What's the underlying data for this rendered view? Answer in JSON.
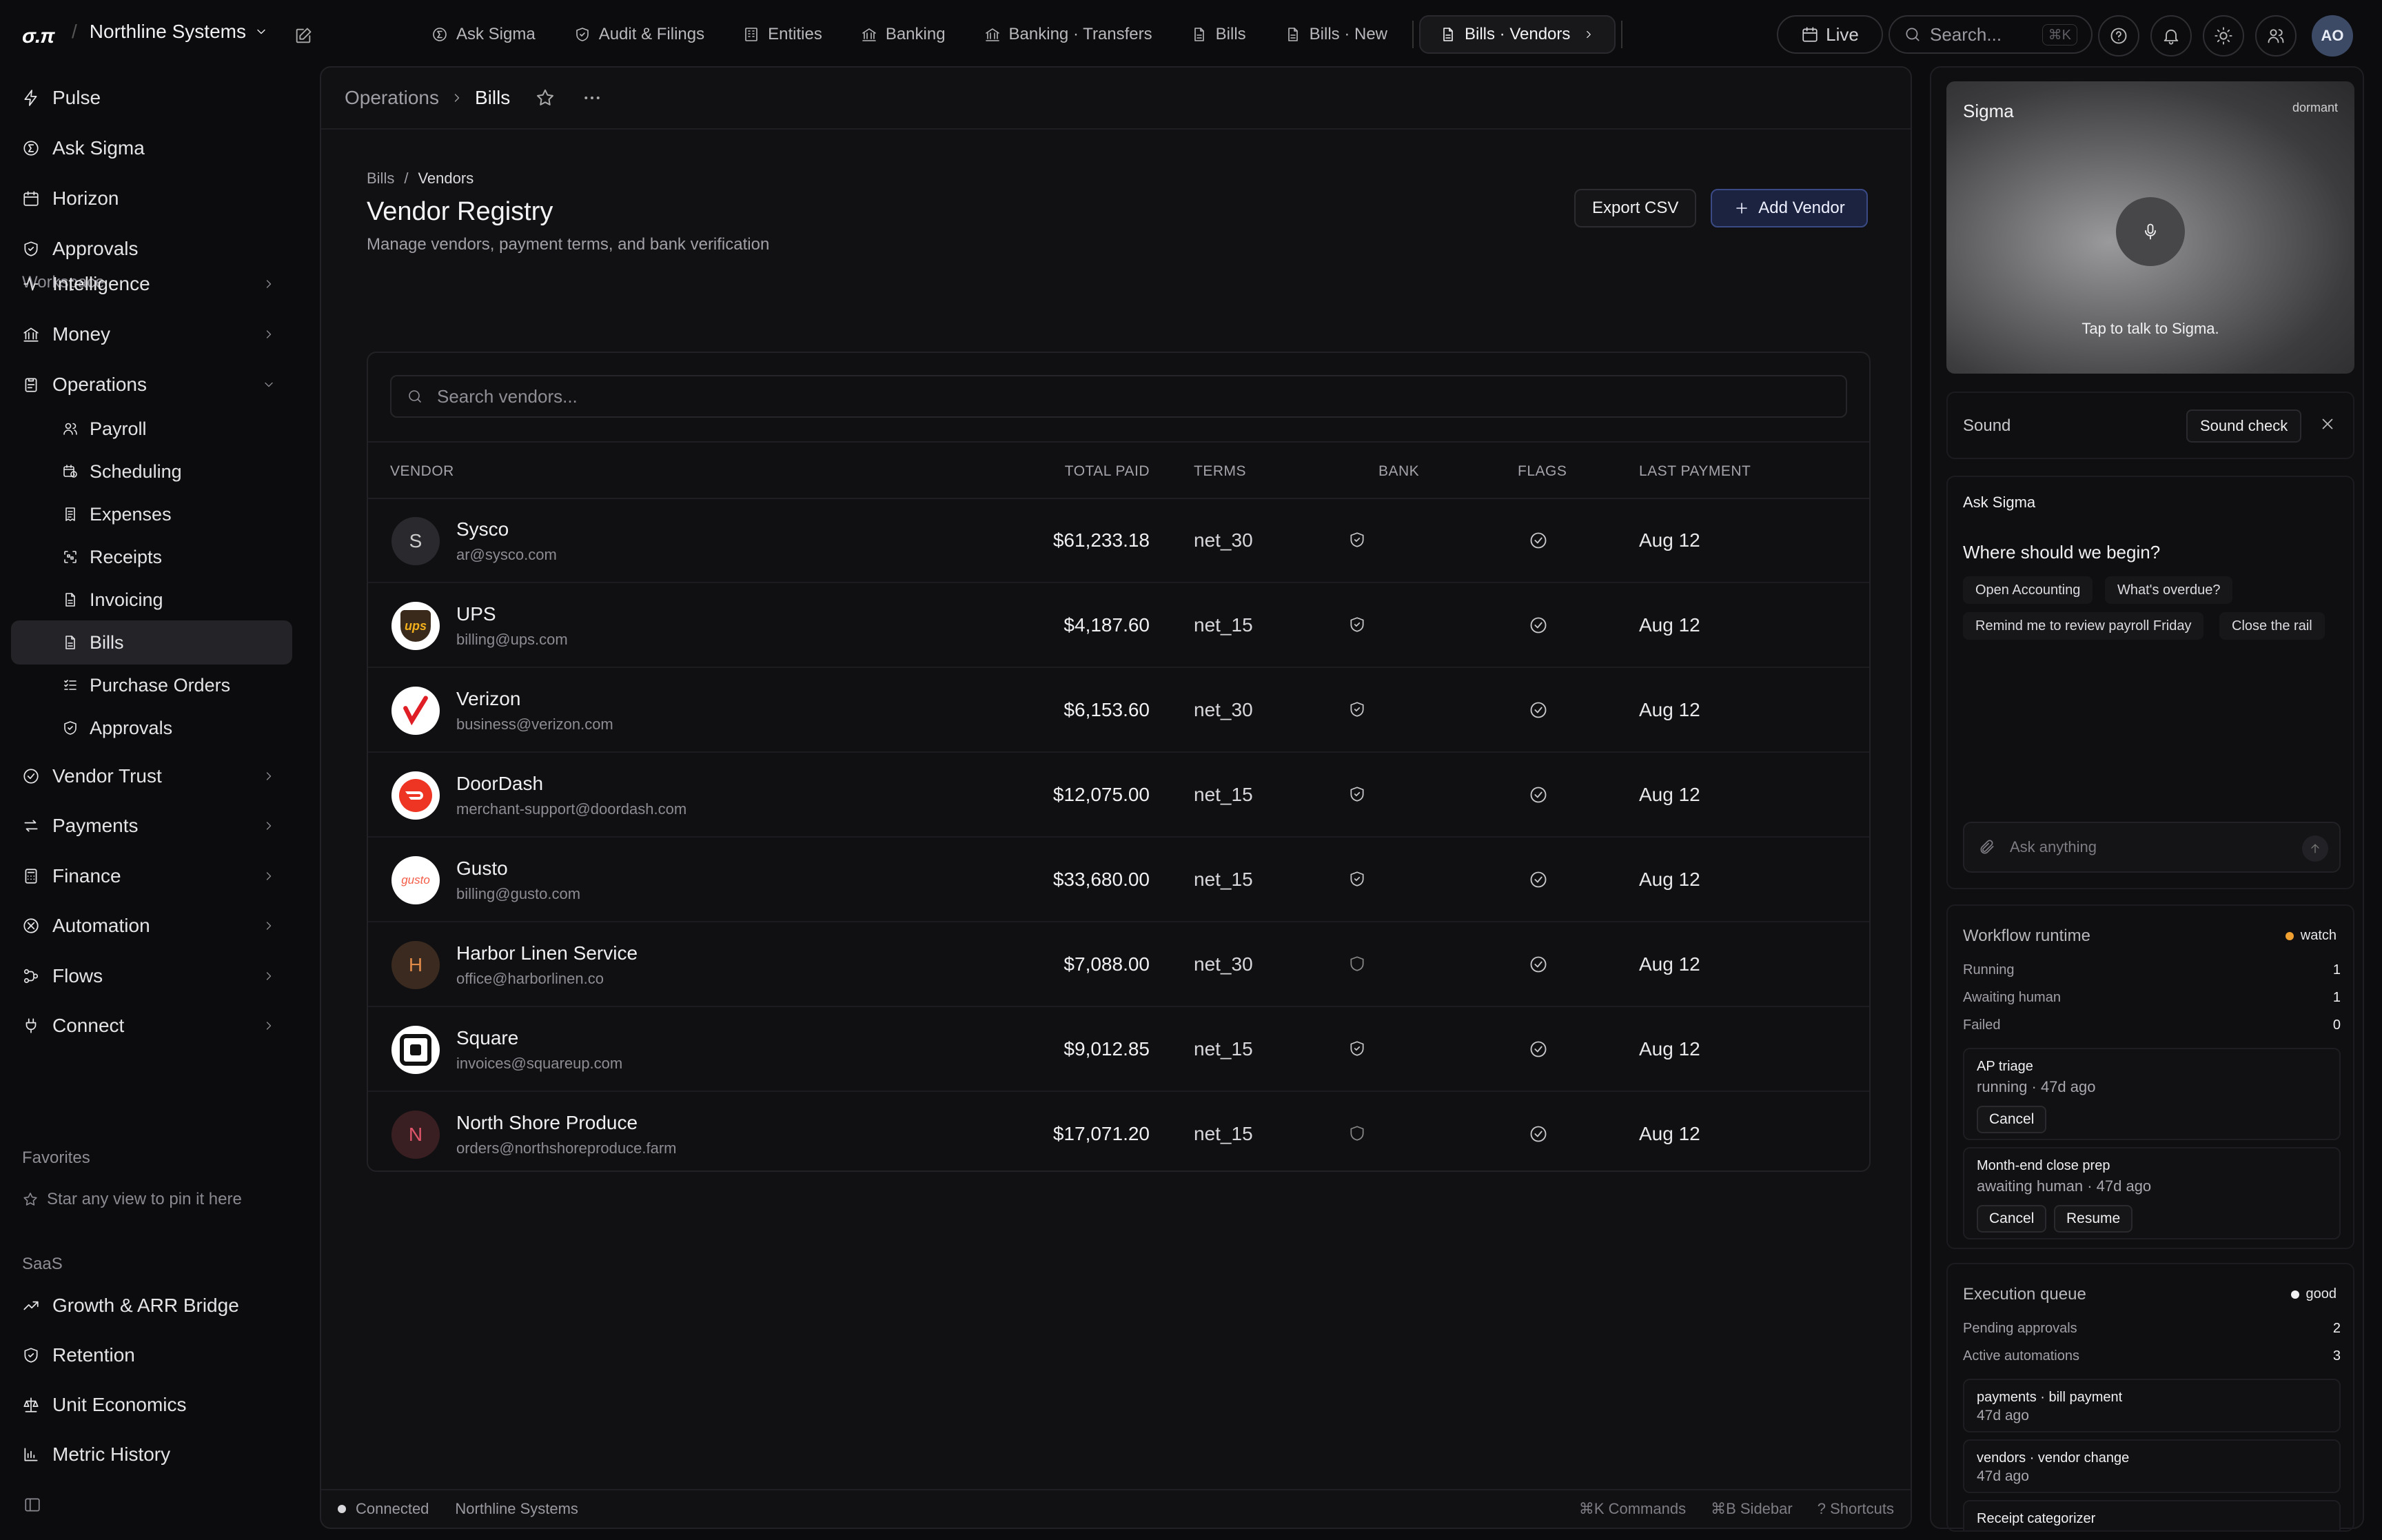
{
  "brand": {
    "logo": "σ.π",
    "org": "Northline Systems"
  },
  "top_tabs": [
    {
      "label": "Ask Sigma",
      "icon": "sigma-icon"
    },
    {
      "label": "Audit & Filings",
      "icon": "shield-icon"
    },
    {
      "label": "Entities",
      "icon": "building-icon"
    },
    {
      "label": "Banking",
      "icon": "bank-icon"
    },
    {
      "label": "Banking · Transfers",
      "icon": "bank-icon"
    },
    {
      "label": "Bills",
      "icon": "document-icon"
    },
    {
      "label": "Bills · New",
      "icon": "document-icon"
    },
    {
      "label": "Bills · Vendors",
      "icon": "document-icon",
      "active": true
    }
  ],
  "topbar": {
    "live_label": "Live",
    "search_placeholder": "Search...",
    "search_kbd": "⌘K",
    "avatar_initials": "AO"
  },
  "sidebar": {
    "top": [
      {
        "label": "Pulse",
        "icon": "pulse-icon"
      },
      {
        "label": "Ask Sigma",
        "icon": "sigma-icon"
      },
      {
        "label": "Horizon",
        "icon": "calendar-icon"
      },
      {
        "label": "Approvals",
        "icon": "shield-icon"
      }
    ],
    "workspace_label": "Workspace",
    "workspace": [
      {
        "label": "Intelligence",
        "icon": "activity-icon"
      },
      {
        "label": "Money",
        "icon": "bank-icon"
      },
      {
        "label": "Operations",
        "icon": "clipboard-icon",
        "expanded": true
      }
    ],
    "operations_sub": [
      {
        "label": "Payroll",
        "icon": "users-icon"
      },
      {
        "label": "Scheduling",
        "icon": "calendar-clock-icon"
      },
      {
        "label": "Expenses",
        "icon": "receipt-icon"
      },
      {
        "label": "Receipts",
        "icon": "scan-icon"
      },
      {
        "label": "Invoicing",
        "icon": "document-icon"
      },
      {
        "label": "Bills",
        "icon": "document-icon",
        "active": true
      },
      {
        "label": "Purchase Orders",
        "icon": "list-check-icon"
      },
      {
        "label": "Approvals",
        "icon": "shield-icon"
      }
    ],
    "workspace_more": [
      {
        "label": "Vendor Trust",
        "icon": "check-circle-icon"
      },
      {
        "label": "Payments",
        "icon": "arrows-icon"
      },
      {
        "label": "Finance",
        "icon": "calculator-icon"
      },
      {
        "label": "Automation",
        "icon": "automation-icon"
      },
      {
        "label": "Flows",
        "icon": "flows-icon"
      },
      {
        "label": "Connect",
        "icon": "plug-icon"
      }
    ],
    "favorites_label": "Favorites",
    "favorites_empty": "Star any view to pin it here",
    "saas_label": "SaaS",
    "saas": [
      {
        "label": "Growth & ARR Bridge",
        "icon": "trend-icon"
      },
      {
        "label": "Retention",
        "icon": "shield-icon"
      },
      {
        "label": "Unit Economics",
        "icon": "scale-icon"
      },
      {
        "label": "Metric History",
        "icon": "bar-chart-icon"
      }
    ]
  },
  "breadcrumb": {
    "parent": "Operations",
    "current": "Bills"
  },
  "page": {
    "crumb_parent": "Bills",
    "crumb_sep": "/",
    "crumb_current": "Vendors",
    "title": "Vendor Registry",
    "subtitle": "Manage vendors, payment terms, and bank verification",
    "export_label": "Export CSV",
    "add_label": "Add Vendor",
    "search_placeholder": "Search vendors..."
  },
  "table": {
    "columns": {
      "vendor": "VENDOR",
      "total": "TOTAL PAID",
      "terms": "TERMS",
      "bank": "BANK",
      "flags": "FLAGS",
      "last": "LAST PAYMENT"
    },
    "rows": [
      {
        "name": "Sysco",
        "email": "ar@sysco.com",
        "total": "$61,233.18",
        "terms": "net_30",
        "bank_verified": true,
        "last": "Aug 12",
        "logo": "S",
        "logo_style": "initial"
      },
      {
        "name": "UPS",
        "email": "billing@ups.com",
        "total": "$4,187.60",
        "terms": "net_15",
        "bank_verified": true,
        "last": "Aug 12",
        "logo": "ups",
        "logo_style": "ups"
      },
      {
        "name": "Verizon",
        "email": "business@verizon.com",
        "total": "$6,153.60",
        "terms": "net_30",
        "bank_verified": true,
        "last": "Aug 12",
        "logo": "✓",
        "logo_style": "verizon"
      },
      {
        "name": "DoorDash",
        "email": "merchant-support@doordash.com",
        "total": "$12,075.00",
        "terms": "net_15",
        "bank_verified": true,
        "last": "Aug 12",
        "logo": "dd",
        "logo_style": "doordash"
      },
      {
        "name": "Gusto",
        "email": "billing@gusto.com",
        "total": "$33,680.00",
        "terms": "net_15",
        "bank_verified": true,
        "last": "Aug 12",
        "logo": "gusto",
        "logo_style": "gusto"
      },
      {
        "name": "Harbor Linen Service",
        "email": "office@harborlinen.co",
        "total": "$7,088.00",
        "terms": "net_30",
        "bank_verified": false,
        "last": "Aug 12",
        "logo": "H",
        "logo_style": "initial-brown"
      },
      {
        "name": "Square",
        "email": "invoices@squareup.com",
        "total": "$9,012.85",
        "terms": "net_15",
        "bank_verified": true,
        "last": "Aug 12",
        "logo": "sq",
        "logo_style": "square"
      },
      {
        "name": "North Shore Produce",
        "email": "orders@northshoreproduce.farm",
        "total": "$17,071.20",
        "terms": "net_15",
        "bank_verified": false,
        "last": "Aug 12",
        "logo": "N",
        "logo_style": "initial-red"
      }
    ]
  },
  "statusbar": {
    "status": "Connected",
    "org": "Northline Systems",
    "commands": "⌘K Commands",
    "sidebar": "⌘B Sidebar",
    "shortcuts": "? Shortcuts"
  },
  "sigma_panel": {
    "title": "Sigma",
    "state": "dormant",
    "tap_text": "Tap to talk to Sigma."
  },
  "sound": {
    "label": "Sound",
    "check_label": "Sound check"
  },
  "ask": {
    "title": "Ask Sigma",
    "question": "Where should we begin?",
    "chips": [
      "Open Accounting",
      "What's overdue?",
      "Remind me to review payroll Friday",
      "Close the rail"
    ],
    "placeholder": "Ask anything"
  },
  "workflow": {
    "title": "Workflow runtime",
    "badge": "watch",
    "badge_color": "#f0a030",
    "stats": [
      {
        "label": "Running",
        "value": "1"
      },
      {
        "label": "Awaiting human",
        "value": "1"
      },
      {
        "label": "Failed",
        "value": "0"
      }
    ],
    "jobs": [
      {
        "name": "AP triage",
        "status": "running · 47d ago",
        "buttons": [
          "Cancel"
        ]
      },
      {
        "name": "Month-end close prep",
        "status": "awaiting human · 47d ago",
        "buttons": [
          "Cancel",
          "Resume"
        ]
      }
    ]
  },
  "queue": {
    "title": "Execution queue",
    "badge": "good",
    "badge_color": "#f0f0f2",
    "stats": [
      {
        "label": "Pending approvals",
        "value": "2"
      },
      {
        "label": "Active automations",
        "value": "3"
      }
    ],
    "items": [
      {
        "name": "payments · bill payment",
        "time": "47d ago"
      },
      {
        "name": "vendors · vendor change",
        "time": "47d ago"
      },
      {
        "name": "Receipt categorizer",
        "time": ""
      }
    ]
  }
}
